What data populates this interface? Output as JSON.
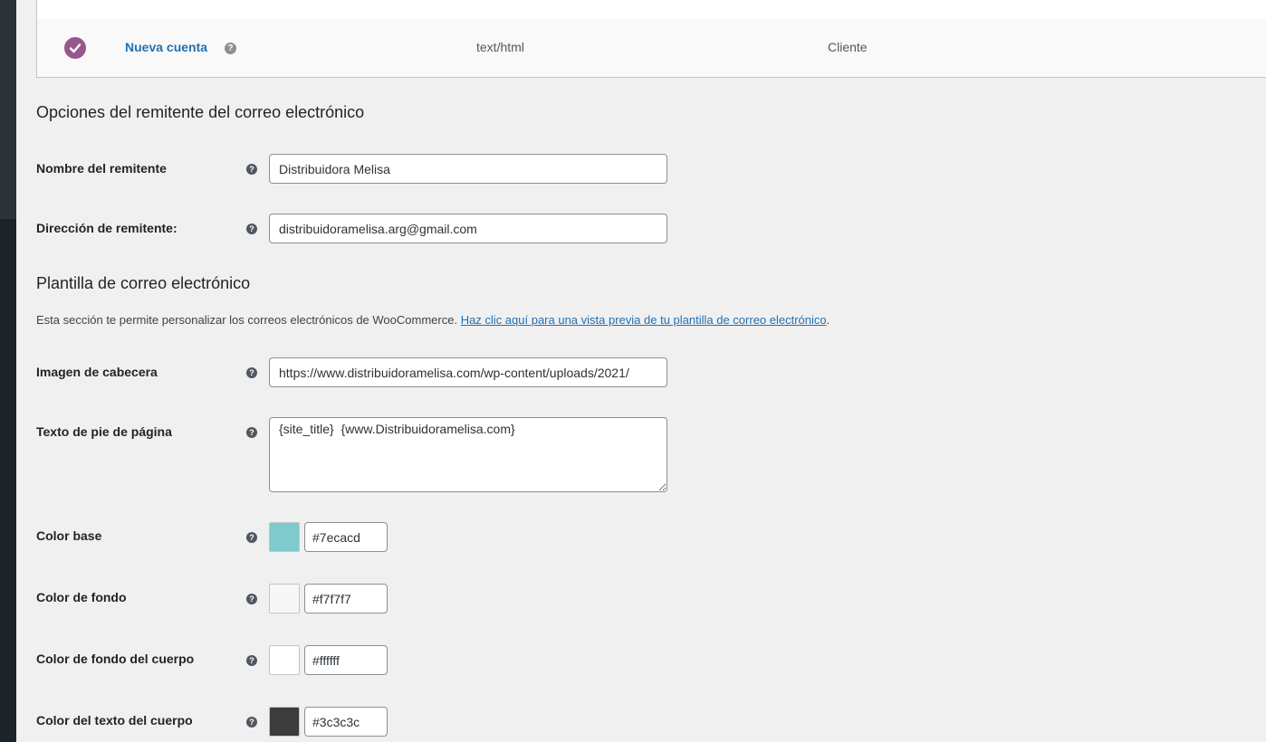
{
  "email_list": {
    "row": {
      "name": "Nueva cuenta",
      "content_type": "text/html",
      "recipient": "Cliente",
      "status_color": "#96588a"
    }
  },
  "sender_section": {
    "title": "Opciones del remitente del correo electrónico",
    "from_name": {
      "label": "Nombre del remitente",
      "value": "Distribuidora Melisa"
    },
    "from_address": {
      "label": "Dirección de remitente:",
      "value": "distribuidoramelisa.arg@gmail.com"
    }
  },
  "template_section": {
    "title": "Plantilla de correo electrónico",
    "description": "Esta sección te permite personalizar los correos electrónicos de WooCommerce. ",
    "preview_link": "Haz clic aquí para una vista previa de tu plantilla de correo electrónico",
    "description_end": ".",
    "header_image": {
      "label": "Imagen de cabecera",
      "value": "https://www.distribuidoramelisa.com/wp-content/uploads/2021/"
    },
    "footer_text": {
      "label": "Texto de pie de página",
      "value": "{site_title}  {www.Distribuidoramelisa.com}"
    },
    "base_color": {
      "label": "Color base",
      "value": "#7ecacd"
    },
    "background_color": {
      "label": "Color de fondo",
      "value": "#f7f7f7"
    },
    "body_background_color": {
      "label": "Color de fondo del cuerpo",
      "value": "#ffffff"
    },
    "body_text_color": {
      "label": "Color del texto del cuerpo",
      "value": "#3c3c3c"
    }
  },
  "help_tip_glyph": "?"
}
